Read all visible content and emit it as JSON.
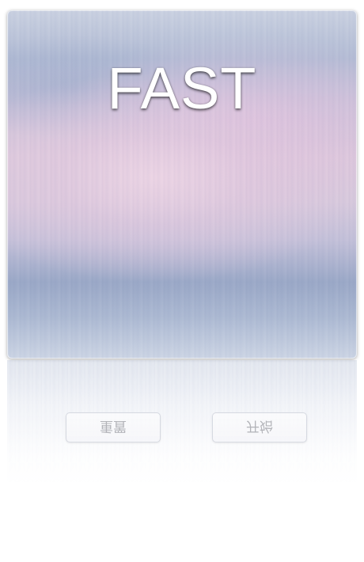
{
  "screen": {
    "title": "FAST"
  },
  "controls": {
    "reset_label": "重置",
    "start_label": "开始"
  },
  "colors": {
    "card_top": "#c3cbdd",
    "card_mid_pink": "#dcc9dc",
    "card_bottom_blue": "#99a7c6",
    "title_text": "#ffffff"
  }
}
